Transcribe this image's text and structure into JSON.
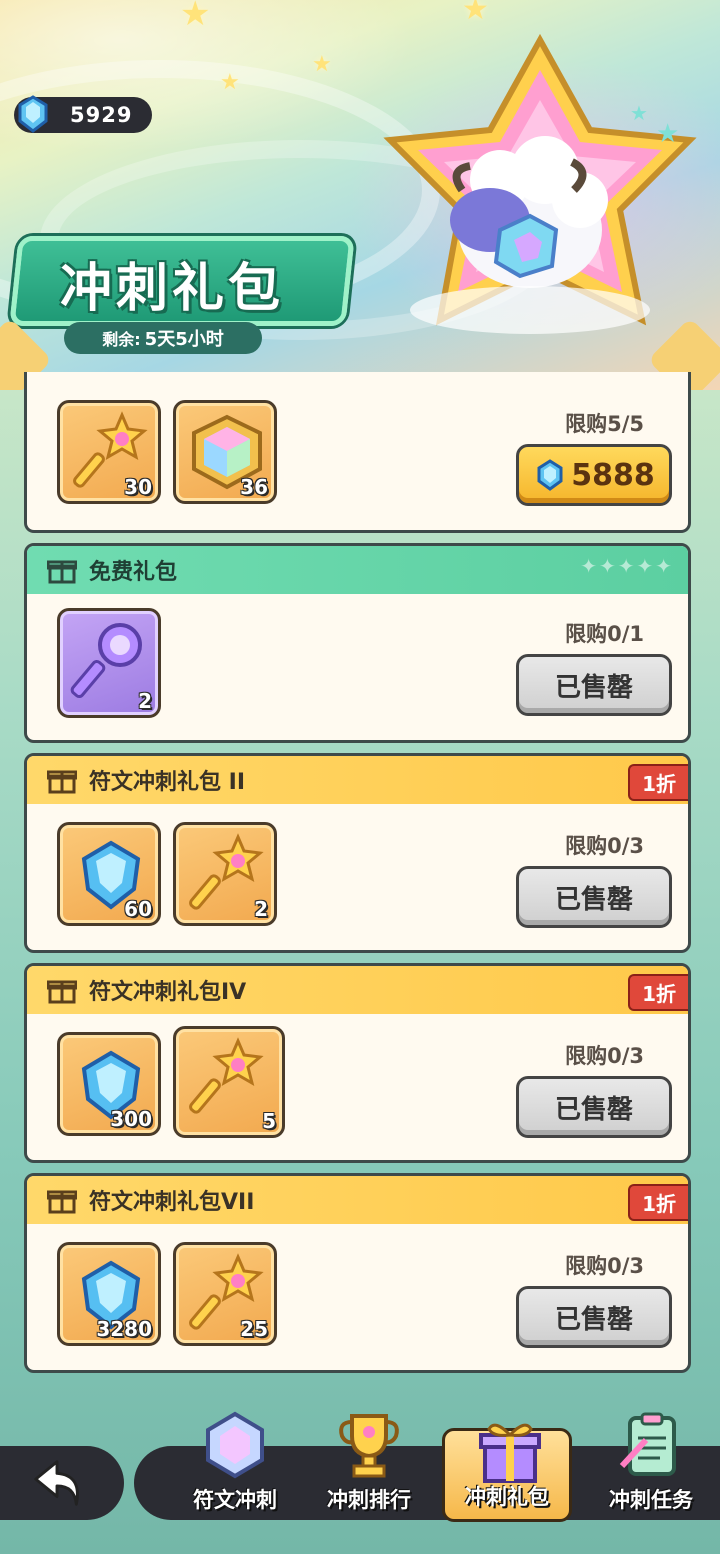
{
  "header": {
    "currency_value": "5929",
    "title": "冲刺礼包",
    "timer_label": "剩余:",
    "timer_value": "5天5小时"
  },
  "packs": [
    {
      "name": "",
      "discount": "",
      "items": [
        {
          "icon": "star-key-icon",
          "qty": "30"
        },
        {
          "icon": "rainbow-cube-icon",
          "qty": "36"
        }
      ],
      "limit": "限购5/5",
      "button": "5888",
      "button_state": "buy"
    },
    {
      "name": "免费礼包",
      "discount": "",
      "items": [
        {
          "icon": "purple-key-icon",
          "qty": "2"
        }
      ],
      "limit": "限购0/1",
      "button": "已售罄",
      "button_state": "sold"
    },
    {
      "name": "符文冲刺礼包 II",
      "discount": "1折",
      "items": [
        {
          "icon": "blue-gem-icon",
          "qty": "60"
        },
        {
          "icon": "star-key-icon",
          "qty": "2"
        }
      ],
      "limit": "限购0/3",
      "button": "已售罄",
      "button_state": "sold"
    },
    {
      "name": "符文冲刺礼包IV",
      "discount": "1折",
      "items": [
        {
          "icon": "blue-gem-icon",
          "qty": "300"
        },
        {
          "icon": "star-key-icon",
          "qty": "5"
        }
      ],
      "limit": "限购0/3",
      "button": "已售罄",
      "button_state": "sold"
    },
    {
      "name": "符文冲刺礼包VII",
      "discount": "1折",
      "items": [
        {
          "icon": "blue-gem-icon",
          "qty": "3280"
        },
        {
          "icon": "star-key-icon",
          "qty": "25"
        }
      ],
      "limit": "限购0/3",
      "button": "已售罄",
      "button_state": "sold"
    }
  ],
  "nav": [
    {
      "label": "符文冲刺",
      "icon": "rune-crystal-icon",
      "active": false
    },
    {
      "label": "冲刺排行",
      "icon": "trophy-icon",
      "active": false
    },
    {
      "label": "冲刺礼包",
      "icon": "gift-box-icon",
      "active": true
    },
    {
      "label": "冲刺任务",
      "icon": "task-clipboard-icon",
      "active": false
    }
  ],
  "colors": {
    "accent_green": "#3fbf96",
    "accent_yellow": "#ffc94a",
    "discount_red": "#e0483a",
    "nav_dark": "#2b2c33"
  }
}
